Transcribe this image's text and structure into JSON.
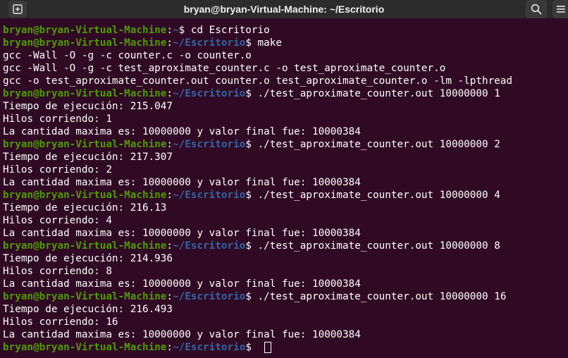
{
  "window": {
    "title": "bryan@bryan-Virtual-Machine: ~/Escritorio",
    "new_tab_icon": "new-tab-icon",
    "search_icon": "search-icon",
    "menu_icon": "hamburger-menu-icon"
  },
  "colors": {
    "background": "#300a24",
    "prompt_user": "#4e9a06",
    "prompt_path": "#3465a4",
    "text": "#ffffff",
    "titlebar": "#2c2c2c"
  },
  "terminal": {
    "prompt_user": "bryan@bryan-Virtual-Machine",
    "lines": [
      {
        "type": "prompt",
        "path": "~",
        "cmd": "cd Escritorio"
      },
      {
        "type": "prompt",
        "path": "~/Escritorio",
        "cmd": "make"
      },
      {
        "type": "output",
        "text": "gcc -Wall -O -g -c counter.c -o counter.o"
      },
      {
        "type": "output",
        "text": "gcc -Wall -O -g -c test_aproximate_counter.c -o test_aproximate_counter.o"
      },
      {
        "type": "output",
        "text": "gcc -o test_aproximate_counter.out counter.o test_aproximate_counter.o -lm -lpthread"
      },
      {
        "type": "prompt",
        "path": "~/Escritorio",
        "cmd": "./test_aproximate_counter.out 10000000 1"
      },
      {
        "type": "output",
        "text": "Tiempo de ejecución: 215.047"
      },
      {
        "type": "output",
        "text": "Hilos corriendo: 1"
      },
      {
        "type": "output",
        "text": "La cantidad maxima es: 10000000 y valor final fue: 10000384"
      },
      {
        "type": "prompt",
        "path": "~/Escritorio",
        "cmd": "./test_aproximate_counter.out 10000000 2"
      },
      {
        "type": "output",
        "text": "Tiempo de ejecución: 217.307"
      },
      {
        "type": "output",
        "text": "Hilos corriendo: 2"
      },
      {
        "type": "output",
        "text": "La cantidad maxima es: 10000000 y valor final fue: 10000384"
      },
      {
        "type": "prompt",
        "path": "~/Escritorio",
        "cmd": "./test_aproximate_counter.out 10000000 4"
      },
      {
        "type": "output",
        "text": "Tiempo de ejecución: 216.13"
      },
      {
        "type": "output",
        "text": "Hilos corriendo: 4"
      },
      {
        "type": "output",
        "text": "La cantidad maxima es: 10000000 y valor final fue: 10000384"
      },
      {
        "type": "prompt",
        "path": "~/Escritorio",
        "cmd": "./test_aproximate_counter.out 10000000 8"
      },
      {
        "type": "output",
        "text": "Tiempo de ejecución: 214.936"
      },
      {
        "type": "output",
        "text": "Hilos corriendo: 8"
      },
      {
        "type": "output",
        "text": "La cantidad maxima es: 10000000 y valor final fue: 10000384"
      },
      {
        "type": "prompt",
        "path": "~/Escritorio",
        "cmd": "./test_aproximate_counter.out 10000000 16"
      },
      {
        "type": "output",
        "text": "Tiempo de ejecución: 216.493"
      },
      {
        "type": "output",
        "text": "Hilos corriendo: 16"
      },
      {
        "type": "output",
        "text": "La cantidad maxima es: 10000000 y valor final fue: 10000384"
      },
      {
        "type": "prompt",
        "path": "~/Escritorio",
        "cmd": "",
        "cursor": true
      }
    ]
  }
}
